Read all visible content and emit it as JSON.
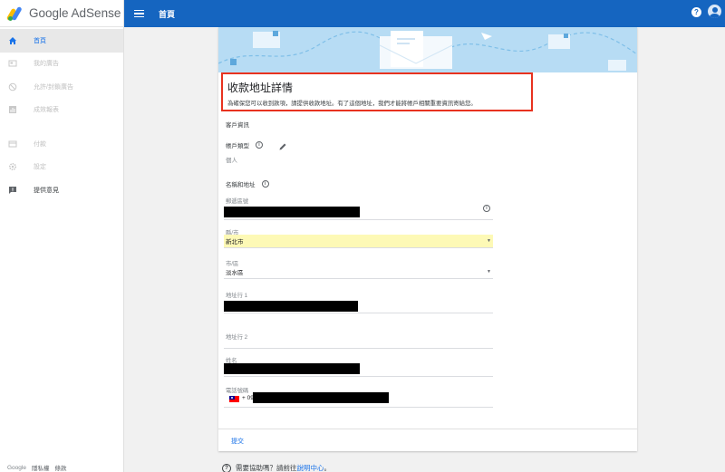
{
  "app": {
    "logo_text": "Google AdSense"
  },
  "topbar": {
    "title": "首頁",
    "help_glyph": "?"
  },
  "sidebar": {
    "items": [
      {
        "label": "首頁",
        "icon": "home-icon",
        "state": "active"
      },
      {
        "label": "我的廣告",
        "icon": "ads-icon",
        "state": "disabled"
      },
      {
        "label": "允許/封鎖廣告",
        "icon": "block-icon",
        "state": "disabled"
      },
      {
        "label": "成效報表",
        "icon": "reports-icon",
        "state": "disabled"
      },
      {
        "label": "付款",
        "icon": "payments-icon",
        "state": "disabled"
      },
      {
        "label": "設定",
        "icon": "settings-icon",
        "state": "disabled"
      },
      {
        "label": "提供意見",
        "icon": "feedback-icon",
        "state": "normal"
      }
    ],
    "footer": {
      "google": "Google",
      "privacy": "隱私權",
      "terms": "條款"
    }
  },
  "form": {
    "title": "收款地址詳情",
    "subtitle": "為確保您可以收到款項，請提供收款地址。有了這個地址，我們才能將帳戶相關重要資訊寄給您。",
    "customer_info_label": "客戶資訊",
    "account_type_label": "帳戶類型",
    "account_type_value": "個人",
    "name_address_label": "名稱和地址",
    "postal_code_label": "郵遞區號",
    "county_label": "縣/市",
    "county_value": "新北市",
    "district_label": "市/區",
    "district_value": "淡水區",
    "address1_label": "地址行 1",
    "address2_label": "地址行 2",
    "name_label": "姓名",
    "phone_label": "電話號碼",
    "phone_prefix": "+ 09",
    "submit_label": "提交"
  },
  "help": {
    "question": "需要協助嗎？請前往",
    "link": "說明中心",
    "suffix": "。"
  },
  "colors": {
    "topbar": "#1565c0",
    "accent": "#1a73e8",
    "highlight_box": "#e8321f",
    "select_highlight": "#fdf9b6"
  }
}
